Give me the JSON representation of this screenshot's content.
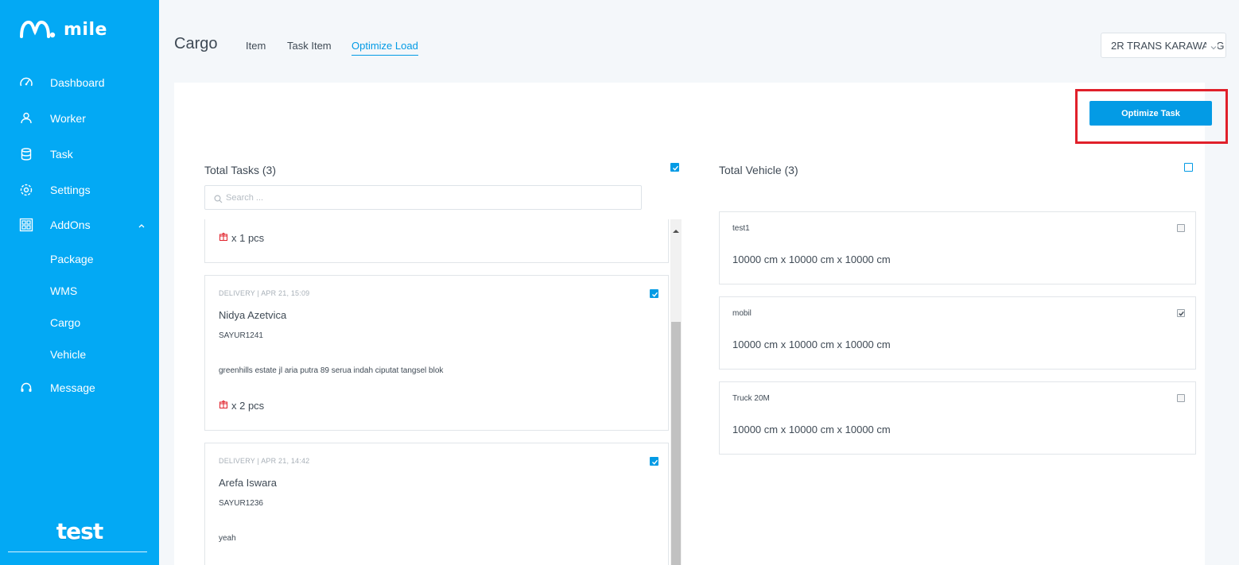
{
  "sidebar": {
    "logo_text": "mile",
    "nav": [
      {
        "label": "Dashboard",
        "icon": "speedometer-icon"
      },
      {
        "label": "Worker",
        "icon": "user-icon"
      },
      {
        "label": "Task",
        "icon": "database-icon"
      },
      {
        "label": "Settings",
        "icon": "gear-icon"
      },
      {
        "label": "AddOns",
        "icon": "grid-icon",
        "expanded": true
      },
      {
        "label": "Message",
        "icon": "headset-icon"
      }
    ],
    "addons": [
      "Package",
      "WMS",
      "Cargo",
      "Vehicle"
    ],
    "brand_bottom": "test"
  },
  "header": {
    "title": "Cargo",
    "tabs": [
      {
        "label": "Item",
        "active": false
      },
      {
        "label": "Task Item",
        "active": false
      },
      {
        "label": "Optimize Load",
        "active": true
      }
    ],
    "org_select": "2R TRANS KARAWANG"
  },
  "toolbar": {
    "optimize_label": "Optimize Task"
  },
  "tasks": {
    "title": "Total Tasks (3)",
    "all_checked": true,
    "search_placeholder": "Search ...",
    "items": [
      {
        "meta": "",
        "name": "",
        "code": "",
        "address": "",
        "qty": "x 1 pcs",
        "checked": true
      },
      {
        "meta": "DELIVERY | APR 21, 15:09",
        "name": "Nidya Azetvica",
        "code": "SAYUR1241",
        "address": "greenhills estate jl aria putra 89 serua indah ciputat tangsel blok",
        "qty": "x 2 pcs",
        "checked": true
      },
      {
        "meta": "DELIVERY | APR 21, 14:42",
        "name": "Arefa Iswara",
        "code": "SAYUR1236",
        "address": "yeah",
        "qty": "",
        "checked": true
      }
    ]
  },
  "vehicles": {
    "title": "Total Vehicle (3)",
    "all_checked": false,
    "items": [
      {
        "name": "test1",
        "dims": "10000 cm x 10000 cm x 10000 cm",
        "checked": false
      },
      {
        "name": "mobil",
        "dims": "10000 cm x 10000 cm x 10000 cm",
        "checked": true
      },
      {
        "name": "Truck 20M",
        "dims": "10000 cm x 10000 cm x 10000 cm",
        "checked": false
      }
    ]
  },
  "colors": {
    "accent": "#03a9f4",
    "button": "#039be5",
    "highlight": "#e0202a"
  }
}
